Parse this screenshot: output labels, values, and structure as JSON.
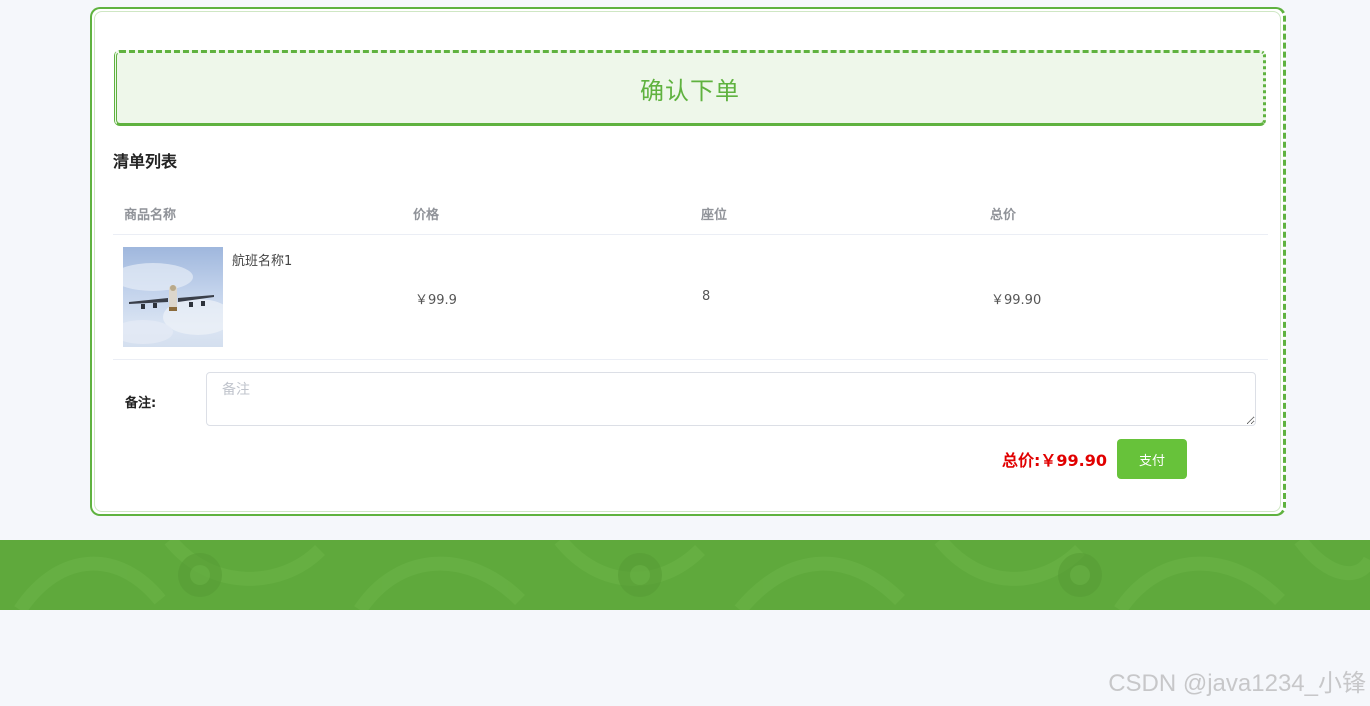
{
  "header": {
    "title": "确认下单"
  },
  "list": {
    "section_title": "清单列表",
    "columns": [
      "商品名称",
      "价格",
      "座位",
      "总价"
    ],
    "rows": [
      {
        "image": "airplane-photo",
        "name": "航班名称1",
        "price": "￥99.9",
        "seat": "8",
        "total": "￥99.90"
      }
    ]
  },
  "remark": {
    "label": "备注:",
    "placeholder": "备注",
    "value": ""
  },
  "summary": {
    "total_label": "总价:",
    "total_value": "￥99.90",
    "pay_label": "支付"
  },
  "watermark": "CSDN @java1234_小锋",
  "colors": {
    "accent": "#5fb23f",
    "pay_button": "#67c23a",
    "total_red": "#e10000",
    "footer_band": "#5fa93c",
    "page_bg": "#f5f7fb"
  }
}
